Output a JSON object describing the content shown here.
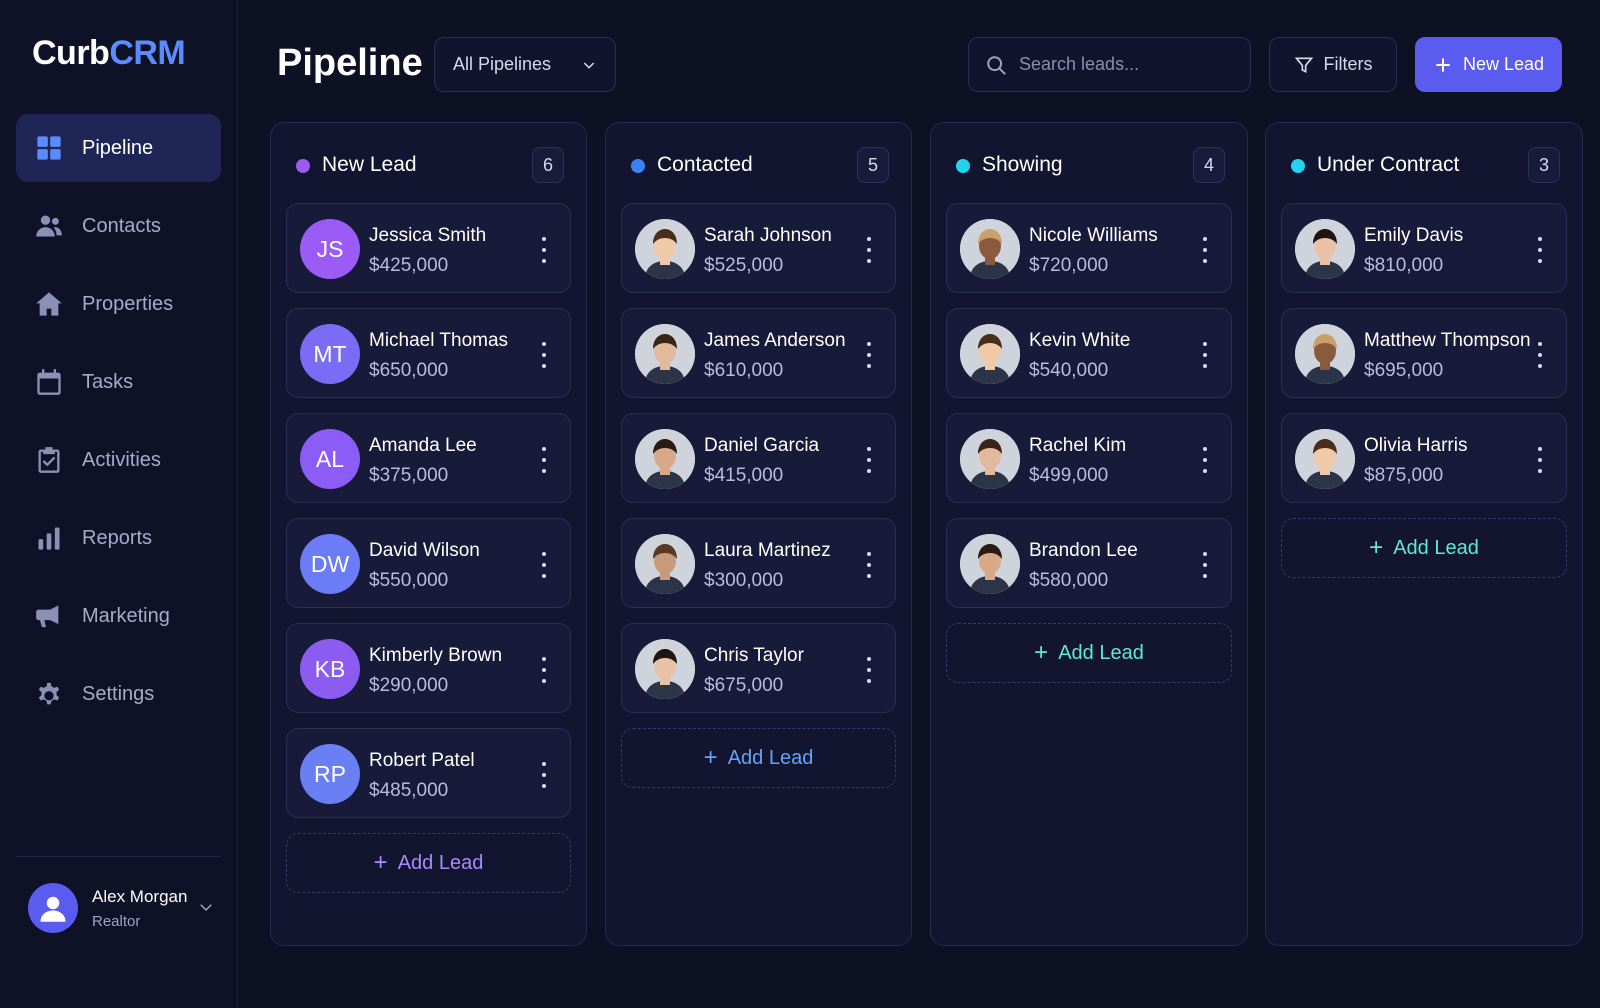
{
  "brand": {
    "name_part1": "Curb",
    "name_part2": "CRM"
  },
  "sidebar": {
    "items": [
      {
        "label": "Pipeline",
        "icon": "grid-icon",
        "active": true
      },
      {
        "label": "Contacts",
        "icon": "users-icon"
      },
      {
        "label": "Properties",
        "icon": "home-icon"
      },
      {
        "label": "Tasks",
        "icon": "calendar-icon"
      },
      {
        "label": "Activities",
        "icon": "clipboard-check-icon"
      },
      {
        "label": "Reports",
        "icon": "bar-chart-icon"
      },
      {
        "label": "Marketing",
        "icon": "megaphone-icon"
      },
      {
        "label": "Settings",
        "icon": "gear-icon"
      }
    ],
    "user": {
      "name": "Alex Morgan",
      "role": "Realtor"
    }
  },
  "header": {
    "title": "Pipeline",
    "pipeline_select": "All Pipelines",
    "search_placeholder": "Search leads...",
    "filters_label": "Filters",
    "new_lead_label": "New Lead"
  },
  "colors": {
    "accent": "#5a5cf0",
    "new_lead": "#9b5cf6",
    "contacted": "#3b82f6",
    "showing": "#22d3ee",
    "under_contract": "#22d3ee",
    "add_lead_purple": "#a78bfa",
    "add_lead_blue": "#60a5fa",
    "add_lead_teal": "#5eead4"
  },
  "columns": [
    {
      "title": "New Lead",
      "count": "6",
      "add_label": "Add Lead",
      "cards": [
        {
          "name": "Jessica Smith",
          "price": "$425,000",
          "initials": "JS"
        },
        {
          "name": "Michael Thomas",
          "price": "$650,000",
          "initials": "MT"
        },
        {
          "name": "Amanda Lee",
          "price": "$375,000",
          "initials": "AL"
        },
        {
          "name": "David Wilson",
          "price": "$550,000",
          "initials": "DW"
        },
        {
          "name": "Kimberly Brown",
          "price": "$290,000",
          "initials": "KB"
        },
        {
          "name": "Robert Patel",
          "price": "$485,000",
          "initials": "RP"
        }
      ]
    },
    {
      "title": "Contacted",
      "count": "5",
      "add_label": "Add Lead",
      "cards": [
        {
          "name": "Sarah Johnson",
          "price": "$525,000"
        },
        {
          "name": "James Anderson",
          "price": "$610,000"
        },
        {
          "name": "Daniel Garcia",
          "price": "$415,000"
        },
        {
          "name": "Laura Martinez",
          "price": "$300,000"
        },
        {
          "name": "Chris Taylor",
          "price": "$675,000"
        }
      ]
    },
    {
      "title": "Showing",
      "count": "4",
      "add_label": "Add Lead",
      "cards": [
        {
          "name": "Nicole Williams",
          "price": "$720,000"
        },
        {
          "name": "Kevin White",
          "price": "$540,000"
        },
        {
          "name": "Rachel Kim",
          "price": "$499,000"
        },
        {
          "name": "Brandon Lee",
          "price": "$580,000"
        }
      ]
    },
    {
      "title": "Under Contract",
      "count": "3",
      "add_label": "Add Lead",
      "cards": [
        {
          "name": "Emily Davis",
          "price": "$810,000"
        },
        {
          "name": "Matthew Thompson",
          "price": "$695,000"
        },
        {
          "name": "Olivia Harris",
          "price": "$875,000"
        }
      ]
    }
  ]
}
